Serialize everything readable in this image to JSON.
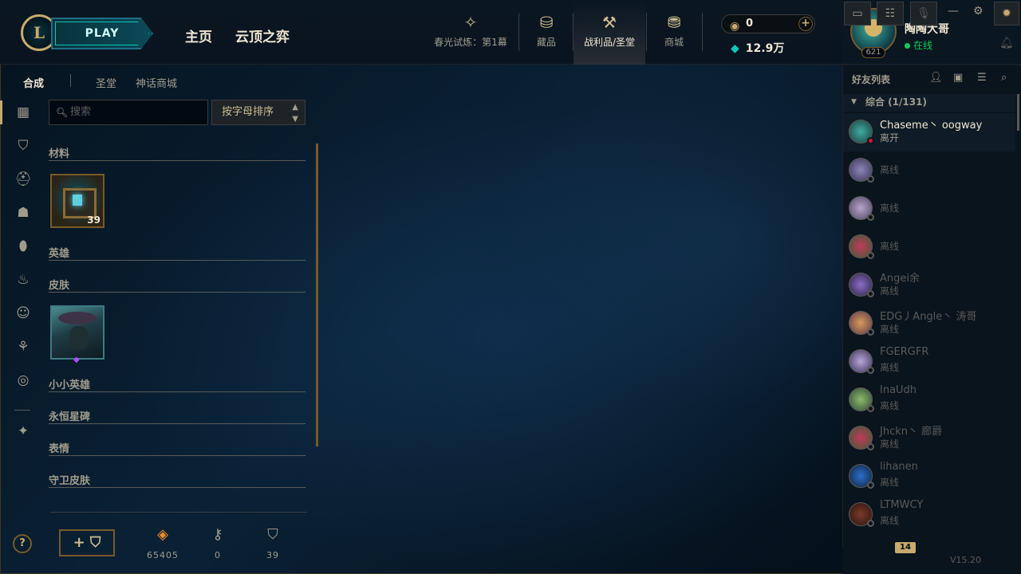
{
  "header": {
    "logo_letter": "L",
    "play_label": "PLAY",
    "nav_main": [
      {
        "label": "主页"
      },
      {
        "label": "云顶之弈"
      }
    ],
    "nav_icons": [
      {
        "label": "春光试炼：第1幕",
        "icon": "event-pass-icon"
      },
      {
        "label": "藏品",
        "icon": "collection-bag-icon"
      },
      {
        "label": "战利品/圣堂",
        "icon": "loot-hammer-icon"
      },
      {
        "label": "商城",
        "icon": "store-coins-icon"
      }
    ],
    "rp_value": "0",
    "be_value": "12.9万"
  },
  "profile": {
    "name": "陶陶大哥",
    "status": "在线",
    "level": "621"
  },
  "subtabs": {
    "crafting": "合成",
    "sanctum": "圣堂",
    "mythic_shop": "神话商城"
  },
  "search": {
    "placeholder": "搜索",
    "sort_label": "按字母排序"
  },
  "inventory": {
    "categories": [
      {
        "label": "材料"
      },
      {
        "label": "英雄"
      },
      {
        "label": "皮肤"
      },
      {
        "label": "小小英雄"
      },
      {
        "label": "永恒星碑"
      },
      {
        "label": "表情"
      },
      {
        "label": "守卫皮肤"
      }
    ],
    "chest_count": "39",
    "stats": [
      {
        "icon": "orange-essence-icon",
        "value": "65405"
      },
      {
        "icon": "key-icon",
        "value": "0"
      },
      {
        "icon": "chest-icon",
        "value": "39"
      }
    ],
    "craft_label": "+ ⛉"
  },
  "friends": {
    "title": "好友列表",
    "group": "综合 (1/131)",
    "list": [
      {
        "name": "Chaseme丶 oogway",
        "state": "离开"
      },
      {
        "name": "",
        "state": "离线"
      },
      {
        "name": "",
        "state": "离线"
      },
      {
        "name": "",
        "state": "离线"
      },
      {
        "name": "Angei余",
        "state": "离线"
      },
      {
        "name": "EDG丿Angle丶 涛哥",
        "state": "离线"
      },
      {
        "name": "FGERGFR",
        "state": "离线"
      },
      {
        "name": "InaUdh",
        "state": "离线"
      },
      {
        "name": "Jhckn丶 廊爵",
        "state": "离线"
      },
      {
        "name": "lihanen",
        "state": "离线"
      },
      {
        "name": "LTMWCY",
        "state": "离线"
      }
    ],
    "badge": "14",
    "version": "V15.20"
  },
  "colors": {
    "gold": "#c8aa6e",
    "teal": "#0ac8b9",
    "online": "#0acb5c",
    "background": "#010a13"
  }
}
